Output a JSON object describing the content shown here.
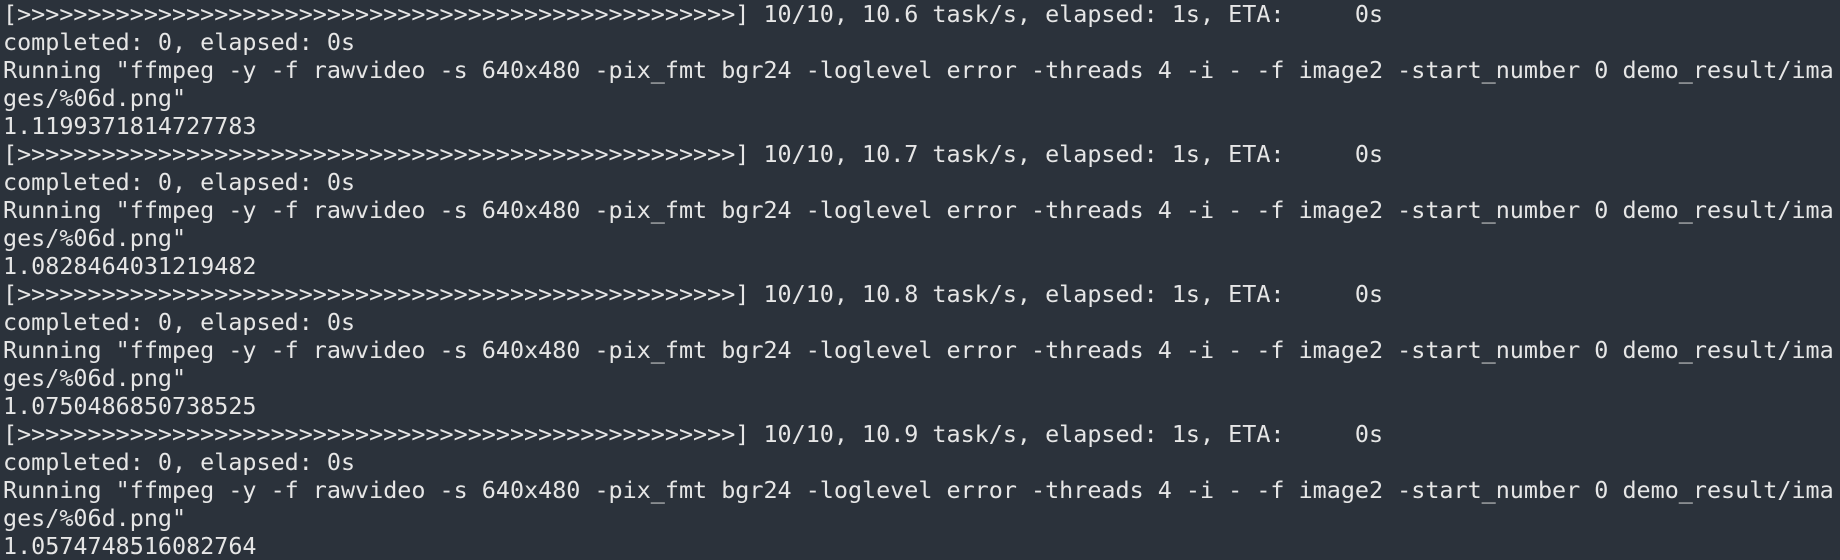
{
  "terminal": {
    "lines": [
      "[>>>>>>>>>>>>>>>>>>>>>>>>>>>>>>>>>>>>>>>>>>>>>>>>>>>] 10/10, 10.6 task/s, elapsed: 1s, ETA:     0s",
      "completed: 0, elapsed: 0s",
      "Running \"ffmpeg -y -f rawvideo -s 640x480 -pix_fmt bgr24 -loglevel error -threads 4 -i - -f image2 -start_number 0 demo_result/ima",
      "ges/%06d.png\"",
      "1.1199371814727783",
      "[>>>>>>>>>>>>>>>>>>>>>>>>>>>>>>>>>>>>>>>>>>>>>>>>>>>] 10/10, 10.7 task/s, elapsed: 1s, ETA:     0s",
      "completed: 0, elapsed: 0s",
      "Running \"ffmpeg -y -f rawvideo -s 640x480 -pix_fmt bgr24 -loglevel error -threads 4 -i - -f image2 -start_number 0 demo_result/ima",
      "ges/%06d.png\"",
      "1.0828464031219482",
      "[>>>>>>>>>>>>>>>>>>>>>>>>>>>>>>>>>>>>>>>>>>>>>>>>>>>] 10/10, 10.8 task/s, elapsed: 1s, ETA:     0s",
      "completed: 0, elapsed: 0s",
      "Running \"ffmpeg -y -f rawvideo -s 640x480 -pix_fmt bgr24 -loglevel error -threads 4 -i - -f image2 -start_number 0 demo_result/ima",
      "ges/%06d.png\"",
      "1.0750486850738525",
      "[>>>>>>>>>>>>>>>>>>>>>>>>>>>>>>>>>>>>>>>>>>>>>>>>>>>] 10/10, 10.9 task/s, elapsed: 1s, ETA:     0s",
      "completed: 0, elapsed: 0s",
      "Running \"ffmpeg -y -f rawvideo -s 640x480 -pix_fmt bgr24 -loglevel error -threads 4 -i - -f image2 -start_number 0 demo_result/ima",
      "ges/%06d.png\"",
      "1.0574748516082764"
    ]
  },
  "colors": {
    "background": "#2b323b",
    "foreground": "#e6e6e6"
  }
}
